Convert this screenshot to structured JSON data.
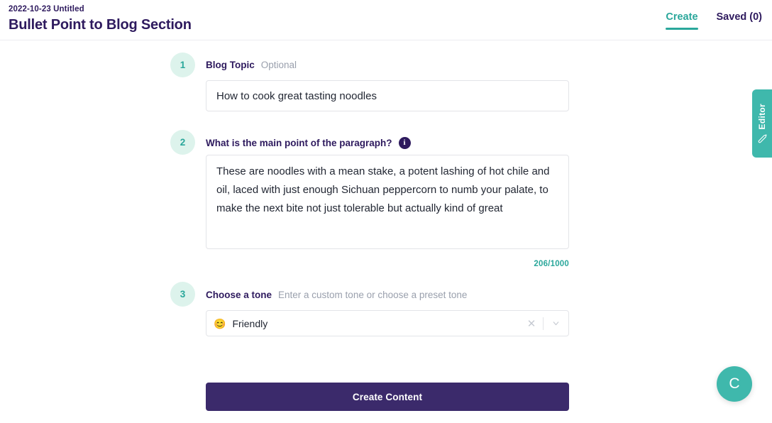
{
  "header": {
    "doc_meta": "2022-10-23 Untitled",
    "doc_title": "Bullet Point to Blog Section",
    "tabs": [
      {
        "label": "Create",
        "active": true
      },
      {
        "label": "Saved (0)",
        "active": false
      }
    ]
  },
  "steps": {
    "one": {
      "number": "1",
      "label": "Blog Topic",
      "hint": "Optional",
      "value": "How to cook great tasting noodles",
      "placeholder": ""
    },
    "two": {
      "number": "2",
      "label": "What is the main point of the paragraph?",
      "info_glyph": "i",
      "value": "These are noodles with a mean stake, a potent lashing of hot chile and oil, laced with just enough Sichuan peppercorn to numb your palate, to make the next bite not just tolerable but actually kind of great",
      "placeholder": "",
      "char_counter": "206/1000"
    },
    "three": {
      "number": "3",
      "label": "Choose a tone",
      "hint": "Enter a custom tone or choose a preset tone",
      "selected_emoji": "😊",
      "selected_value": "Friendly",
      "clear_glyph": "✕"
    }
  },
  "submit": {
    "label": "Create Content"
  },
  "editor_tab": {
    "label": "Editor"
  },
  "chat": {
    "glyph": "C"
  },
  "colors": {
    "brand_navy": "#2e1a5e",
    "accent_teal": "#2aa79b",
    "fab_teal": "#3fb8ac",
    "step_bg": "#ddf3ec",
    "button_purple": "#3b2a6b"
  }
}
